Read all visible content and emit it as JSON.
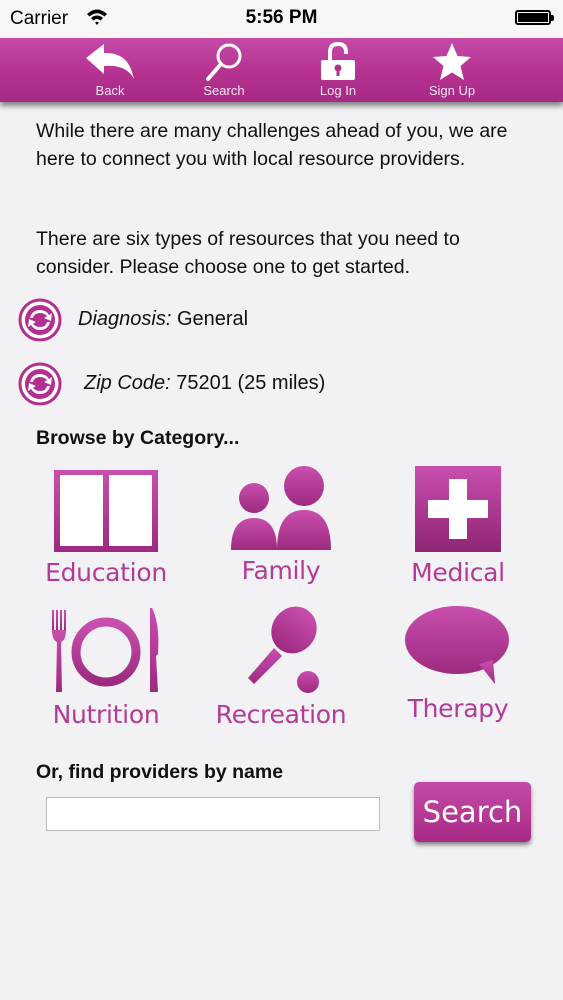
{
  "status_bar": {
    "carrier": "Carrier",
    "time": "5:56 PM"
  },
  "toolbar": {
    "color": "#b4308f",
    "items": [
      {
        "label": "Back",
        "icon": "back-arrow-icon"
      },
      {
        "label": "Search",
        "icon": "magnifier-icon"
      },
      {
        "label": "Log In",
        "icon": "unlock-icon"
      },
      {
        "label": "Sign Up",
        "icon": "star-icon"
      }
    ]
  },
  "intro": {
    "paragraph1": "While there are many challenges ahead of you, we are here to connect you with local resource providers.",
    "paragraph2": "There are six types of resources that you need to consider. Please choose one to get started."
  },
  "filters": {
    "diagnosis_label": "Diagnosis:",
    "diagnosis_value": "General",
    "zip_label": "Zip Code:",
    "zip_value": "75201 (25 miles)"
  },
  "browse": {
    "title": "Browse by Category...",
    "categories": [
      {
        "label": "Education",
        "icon": "book-icon"
      },
      {
        "label": "Family",
        "icon": "family-icon"
      },
      {
        "label": "Medical",
        "icon": "medical-cross-icon"
      },
      {
        "label": "Nutrition",
        "icon": "plate-fork-knife-icon"
      },
      {
        "label": "Recreation",
        "icon": "paddle-ball-icon"
      },
      {
        "label": "Therapy",
        "icon": "speech-bubble-icon"
      }
    ]
  },
  "provider_search": {
    "title": "Or, find providers by name",
    "input_value": "",
    "button_label": "Search"
  },
  "accent_color": "#b33b98"
}
